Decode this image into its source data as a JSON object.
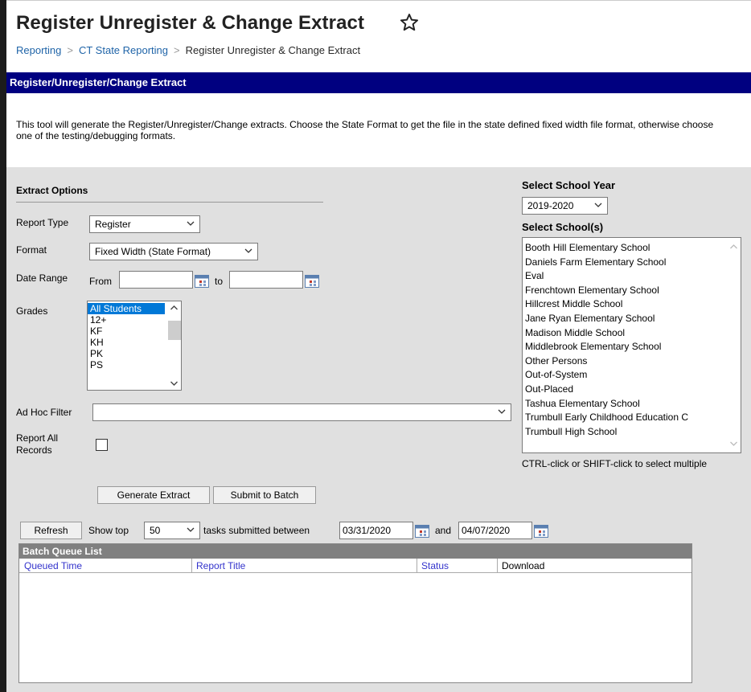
{
  "header": {
    "title": "Register Unregister & Change Extract",
    "breadcrumb": [
      "Reporting",
      "CT State Reporting",
      "Register Unregister & Change Extract"
    ]
  },
  "banner": {
    "title": "Register/Unregister/Change Extract"
  },
  "description": "This tool will generate the Register/Unregister/Change extracts. Choose the State Format to get the file in the state defined fixed width file format, otherwise choose one of the testing/debugging formats.",
  "extract_options": {
    "title": "Extract Options",
    "report_type": {
      "label": "Report Type",
      "value": "Register"
    },
    "format": {
      "label": "Format",
      "value": "Fixed Width (State Format)"
    },
    "date_range": {
      "label": "Date Range",
      "from_label": "From",
      "to_label": "to",
      "from_value": "",
      "to_value": ""
    },
    "grades": {
      "label": "Grades",
      "options": [
        "All Students",
        "12+",
        "KF",
        "KH",
        "PK",
        "PS"
      ],
      "selected": "All Students"
    },
    "ad_hoc_filter": {
      "label": "Ad Hoc Filter",
      "value": ""
    },
    "report_all_records": {
      "label_line1": "Report All",
      "label_line2": "Records",
      "checked": false
    }
  },
  "school_year": {
    "label": "Select School Year",
    "value": "2019-2020"
  },
  "schools": {
    "label": "Select School(s)",
    "options": [
      "Booth Hill Elementary School",
      "Daniels Farm Elementary School",
      "Eval",
      "Frenchtown Elementary School",
      "Hillcrest Middle School",
      "Jane Ryan Elementary School",
      "Madison Middle School",
      "Middlebrook Elementary School",
      "Other Persons",
      "Out-of-System",
      "Out-Placed",
      "Tashua Elementary School",
      "Trumbull Early Childhood Education C",
      "Trumbull High School"
    ],
    "hint": "CTRL-click or SHIFT-click to select multiple"
  },
  "buttons": {
    "generate": "Generate Extract",
    "submit_batch": "Submit to Batch",
    "refresh": "Refresh"
  },
  "batch_filter": {
    "show_top_label": "Show top",
    "top_value": "50",
    "between_label": "tasks submitted between",
    "start_date": "03/31/2020",
    "and_label": "and",
    "end_date": "04/07/2020"
  },
  "batch_queue": {
    "title": "Batch Queue List",
    "columns": [
      "Queued Time",
      "Report Title",
      "Status",
      "Download"
    ]
  },
  "colors": {
    "banner": "#000080",
    "link": "#1f64a8",
    "selected": "#0078d7"
  }
}
